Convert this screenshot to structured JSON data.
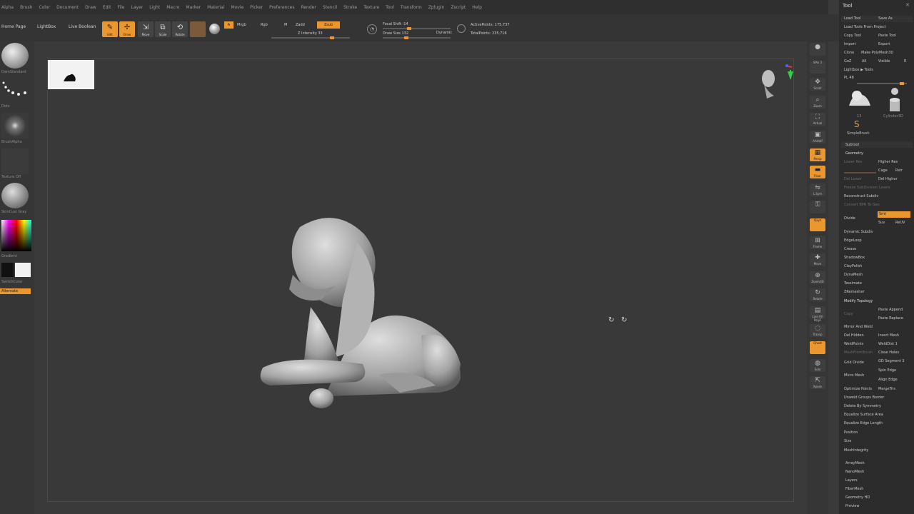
{
  "menu": [
    "Alpha",
    "Brush",
    "Color",
    "Document",
    "Draw",
    "Edit",
    "File",
    "Layer",
    "Light",
    "Macro",
    "Marker",
    "Material",
    "Movie",
    "Picker",
    "Preferences",
    "Render",
    "Stencil",
    "Stroke",
    "Texture",
    "Tool",
    "Transform",
    "Zplugin",
    "Zscript",
    "Help"
  ],
  "shelf": {
    "home_page": "Home Page",
    "lightbox": "LightBox",
    "live_boolean": "Live Boolean",
    "edit": "Edit",
    "draw": "Draw",
    "move": "Move",
    "scale": "Scale",
    "rotate": "Rotate",
    "a_label": "A",
    "mrgb": "Mrgb",
    "rgb": "Rgb",
    "m": "M",
    "zadd": "Zadd",
    "zsub": "Zsub",
    "z_intensity": "Z Intensity 33",
    "focal_shift": "Focal Shift -14",
    "draw_size": "Draw Size 132",
    "dynamic": "Dynamic",
    "active_points": "ActivePoints: 175,737",
    "total_points": "TotalPoints: 235,716"
  },
  "left": {
    "brush": "DamStandard",
    "stroke": "Dots",
    "alpha": "BrushAlpha",
    "texture": "Texture Off",
    "material": "SkinCust Gray",
    "gradient": "Gradient",
    "switch_color": "SwitchColor",
    "alternate": "Alternate"
  },
  "rightstrip": [
    {
      "label": "",
      "icon": "sphere-icon",
      "glyph": "●",
      "on": false
    },
    {
      "label": "SPix 3",
      "icon": "spix-icon",
      "glyph": "",
      "on": false
    },
    {
      "label": "Scroll",
      "icon": "scroll-icon",
      "glyph": "✥",
      "on": false
    },
    {
      "label": "Zoom",
      "icon": "zoom-icon",
      "glyph": "⌕",
      "on": false
    },
    {
      "label": "Actual",
      "icon": "actual-icon",
      "glyph": "⛶",
      "on": false
    },
    {
      "label": "AAHalf",
      "icon": "aahalf-icon",
      "glyph": "▣",
      "on": false
    },
    {
      "label": "Persp",
      "icon": "persp-icon",
      "glyph": "▦",
      "on": true
    },
    {
      "label": "Floor",
      "icon": "floor-icon",
      "glyph": "▬",
      "on": true
    },
    {
      "label": "L.Sym",
      "icon": "lsym-icon",
      "glyph": "⇋",
      "on": false
    },
    {
      "label": "",
      "icon": "lock-icon",
      "glyph": "⚿",
      "on": false
    },
    {
      "label": "Qxyz",
      "icon": "qxyz-icon",
      "glyph": "",
      "on": true
    },
    {
      "label": "Frame",
      "icon": "frame-icon",
      "glyph": "⊞",
      "on": false
    },
    {
      "label": "Move",
      "icon": "move-icon",
      "glyph": "✚",
      "on": false
    },
    {
      "label": "Zoom3D",
      "icon": "zoom3d-icon",
      "glyph": "⊕",
      "on": false
    },
    {
      "label": "Rotate",
      "icon": "rotate-icon",
      "glyph": "↻",
      "on": false
    },
    {
      "label": "Line Fill PolyF",
      "icon": "polyf-icon",
      "glyph": "▤",
      "on": false
    },
    {
      "label": "Transp",
      "icon": "transp-icon",
      "glyph": "◌",
      "on": false
    },
    {
      "label": "Ghost",
      "icon": "ghost-icon",
      "glyph": "",
      "on": true
    },
    {
      "label": "Solo",
      "icon": "solo-icon",
      "glyph": "◍",
      "on": false
    },
    {
      "label": "Xpose",
      "icon": "xpose-icon",
      "glyph": "⇱",
      "on": false
    }
  ],
  "panel": {
    "title": "Tool",
    "load_tool": "Load Tool",
    "save_as": "Save As",
    "load_project": "Load Tools From Project",
    "copy_tool": "Copy Tool",
    "paste_tool": "Paste Tool",
    "import": "Import",
    "export": "Export",
    "clone": "Clone",
    "make_polymesh": "Make PolyMesh3D",
    "goz": "GoZ",
    "all": "All",
    "visible": "Visible",
    "r": "R",
    "lightbox_tools": "Lightbox ▶ Tools",
    "pl": "PL 48",
    "subtool": "Subtool",
    "geometry": "Geometry",
    "lower_res": "Lower Res",
    "higher_res": "Higher Res",
    "sdiv": "SDiv",
    "cage": "Cage",
    "rstr": "Rstr",
    "del_lower": "Del Lower",
    "del_higher": "Del Higher",
    "freeze": "Freeze SubDivision Levels",
    "reconstruct": "Reconstruct Subdiv",
    "convert_bpr": "Convert BPR To Geo",
    "divide": "Divide",
    "smt": "Smt",
    "suv": "Suv",
    "reuv": "ReUV",
    "dynamic_subdiv": "Dynamic Subdiv",
    "edgeloop": "EdgeLoop",
    "crease": "Crease",
    "shadowbox": "ShadowBox",
    "claypolish": "ClayPolish",
    "dynamesh": "DynaMesh",
    "tessimate": "Tessimate",
    "zremesher": "ZRemesher",
    "modify_topology": "Modify Topology",
    "copy": "Copy",
    "paste_append": "Paste Append",
    "paste_replace": "Paste Replace",
    "mirror_weld": "Mirror And Weld",
    "del_hidden": "Del Hidden",
    "insert_mesh": "Insert Mesh",
    "weld_points": "WeldPoints",
    "weld_dist": "WeldDist 1",
    "mesh_from_brush": "MeshFromBrush",
    "close_holes": "Close Holes",
    "grid_divide": "Grid Divide",
    "gd_segment": "GD Segment 3",
    "spin_edge": "Spin Edge",
    "micro_mesh": "Micro Mesh",
    "align_edge": "Align Edge",
    "optimize_points": "Optimize Points",
    "merge_tris": "MergeTris",
    "unweld_groups": "Unweld Groups Border",
    "delete_by_symmetry": "Delete By Symmetry",
    "equalize_surface": "Equalize Surface Area",
    "equalize_edge": "Equalize Edge Length",
    "position": "Position",
    "size": "Size",
    "mesh_integrity": "MeshIntegrity",
    "array_mesh": "ArrayMesh",
    "nano_mesh": "NanoMesh",
    "layers": "Layers",
    "fiber_mesh": "FiberMesh",
    "geometry_hd": "Geometry HD",
    "preview": "Preview",
    "thumb1": "13",
    "thumb2": "Cylinder3D",
    "simplebrush": "SimpleBrush"
  },
  "colors": {
    "accent": "#e9972e",
    "bg": "#3a3a3a",
    "panel": "#2c2c2c"
  }
}
